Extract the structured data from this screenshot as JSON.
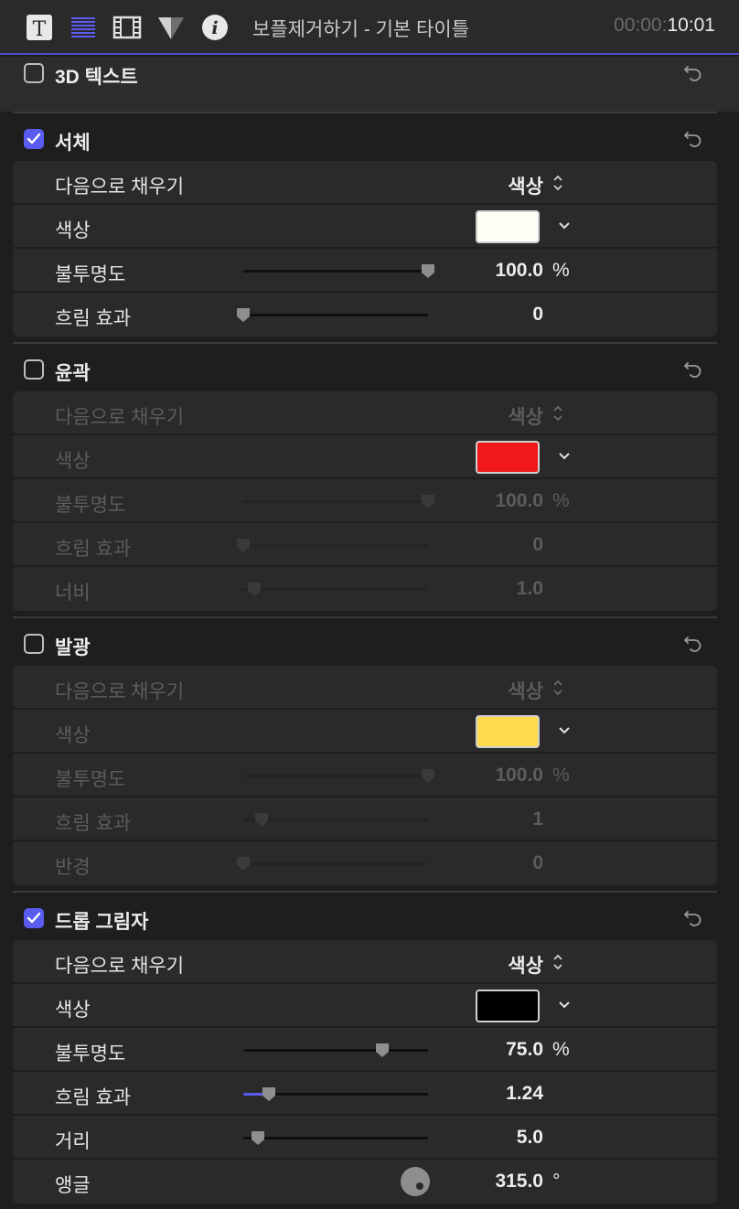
{
  "header": {
    "title": "보플제거하기 - 기본 타이틀",
    "timecode_dim": "00:00:",
    "timecode_bright": "10:01"
  },
  "sections": {
    "text3d": {
      "title": "3D 텍스트",
      "checked": false
    },
    "face": {
      "title": "서체",
      "checked": true,
      "fill_label": "다음으로 채우기",
      "fill_value": "색상",
      "color_label": "색상",
      "color": "#fffff8",
      "opacity_label": "불투명도",
      "opacity_value": "100.0",
      "opacity_unit": "%",
      "opacity": 1.0,
      "blur_label": "흐림 효과",
      "blur_value": "0",
      "blur": 0.0
    },
    "outline": {
      "title": "윤곽",
      "checked": false,
      "fill_label": "다음으로 채우기",
      "fill_value": "색상",
      "color_label": "색상",
      "color": "#f01818",
      "opacity_label": "불투명도",
      "opacity_value": "100.0",
      "opacity_unit": "%",
      "opacity": 1.0,
      "blur_label": "흐림 효과",
      "blur_value": "0",
      "blur": 0.0,
      "width_label": "너비",
      "width_value": "1.0",
      "width": 0.06
    },
    "glow": {
      "title": "발광",
      "checked": false,
      "fill_label": "다음으로 채우기",
      "fill_value": "색상",
      "color_label": "색상",
      "color": "#ffdb4d",
      "opacity_label": "불투명도",
      "opacity_value": "100.0",
      "opacity_unit": "%",
      "opacity": 1.0,
      "blur_label": "흐림 효과",
      "blur_value": "1",
      "blur": 0.1,
      "radius_label": "반경",
      "radius_value": "0",
      "radius": 0.0
    },
    "drop_shadow": {
      "title": "드롭 그림자",
      "checked": true,
      "fill_label": "다음으로 채우기",
      "fill_value": "색상",
      "color_label": "색상",
      "color": "#000000",
      "opacity_label": "불투명도",
      "opacity_value": "75.0",
      "opacity_unit": "%",
      "opacity": 0.75,
      "blur_label": "흐림 효과",
      "blur_value": "1.24",
      "blur": 0.14,
      "distance_label": "거리",
      "distance_value": "5.0",
      "distance": 0.08,
      "angle_label": "앵글",
      "angle_value": "315.0",
      "angle_unit": "°"
    }
  },
  "colors": {
    "accent": "#5a5cf0",
    "background": "#1e1e1f"
  },
  "icons": [
    "text-inspector-icon",
    "paragraph-icon",
    "video-inspector-icon",
    "generator-icon",
    "info-icon",
    "reset-icon",
    "stepper-icon",
    "chevron-down-icon"
  ]
}
